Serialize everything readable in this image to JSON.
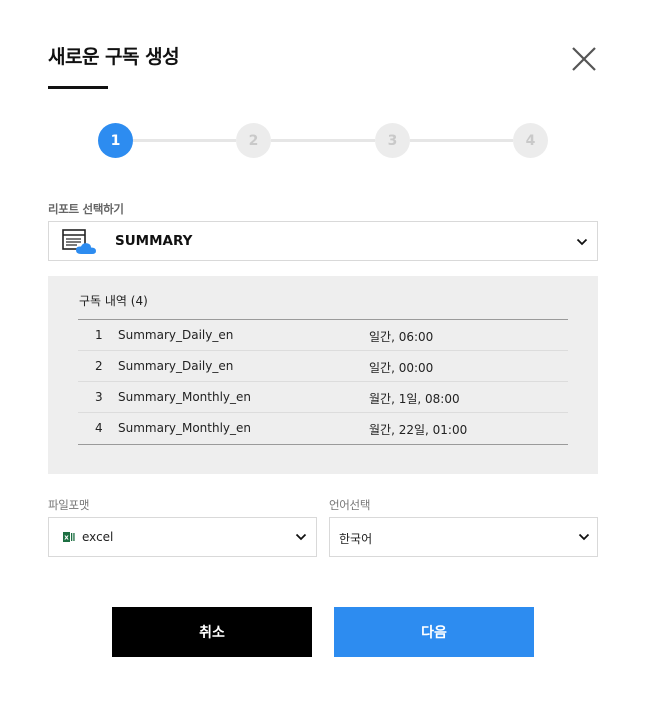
{
  "dialog": {
    "title": "새로운 구독 생성"
  },
  "stepper": {
    "steps": [
      "1",
      "2",
      "3",
      "4"
    ],
    "active_step": 1
  },
  "report": {
    "label": "리포트 선택하기",
    "selected": "SUMMARY",
    "icon": "report-window-cloud-icon"
  },
  "subscriptions": {
    "title": "구독 내역 (4)",
    "rows": [
      {
        "num": "1",
        "name": "Summary_Daily_en",
        "schedule": "일간, 06:00"
      },
      {
        "num": "2",
        "name": "Summary_Daily_en",
        "schedule": "일간, 00:00"
      },
      {
        "num": "3",
        "name": "Summary_Monthly_en",
        "schedule": "월간, 1일, 08:00"
      },
      {
        "num": "4",
        "name": "Summary_Monthly_en",
        "schedule": "월간, 22일, 01:00"
      }
    ]
  },
  "file_format": {
    "label": "파일포맷",
    "selected": "excel",
    "icon": "excel-icon"
  },
  "language": {
    "label": "언어선택",
    "selected": "한국어"
  },
  "buttons": {
    "cancel": "취소",
    "next": "다음"
  },
  "colors": {
    "accent": "#2d8cf0",
    "cancel_bg": "#000000",
    "panel_bg": "#eeeeee",
    "step_inactive": "#ececec"
  }
}
